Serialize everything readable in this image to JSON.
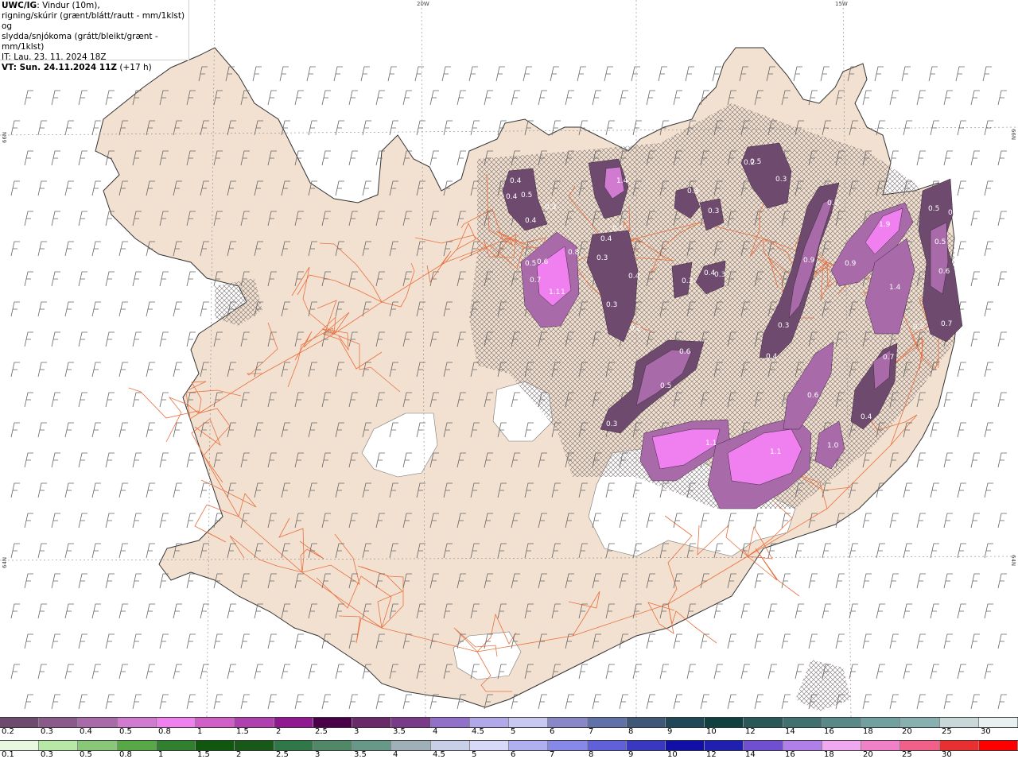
{
  "info": {
    "title_bold": "UWC/IG",
    "title_rest": ": Vindur (10m),",
    "line2": "rigning/skúrir (grænt/blátt/rautt - mm/1klst) og",
    "line3": "slydda/snjókoma (grátt/bleikt/grænt - mm/1klst)",
    "it": "IT: Lau. 23. 11. 2024 18Z",
    "vt_bold": "VT: Sun. 24.11.2024 11Z",
    "vt_rest": " (+17 h)"
  },
  "coords": {
    "top_left": "20W",
    "top_right": "15W",
    "left_upper": "66N",
    "right_upper": "66N",
    "left_lower": "64N",
    "right_lower": "64N"
  },
  "legend_snow": {
    "labels": [
      "0.2",
      "0.3",
      "0.4",
      "0.5",
      "0.8",
      "1",
      "1.5",
      "2",
      "2.5",
      "3",
      "3.5",
      "4",
      "4.5",
      "5",
      "6",
      "7",
      "8",
      "9",
      "10",
      "12",
      "14",
      "16",
      "18",
      "20",
      "25",
      "30"
    ],
    "colors": [
      "#6e4a6e",
      "#8a5a8a",
      "#a86aa8",
      "#d07ad0",
      "#f080f0",
      "#d060c8",
      "#b040b0",
      "#901890",
      "#4a0048",
      "#6a2a6a",
      "#7a3a8a",
      "#9070c8",
      "#b0a8e8",
      "#c8c8f0",
      "#8888c8",
      "#6070a8",
      "#405878",
      "#204858",
      "#104040",
      "#285858",
      "#407070",
      "#588888",
      "#70a0a0",
      "#88b0b0",
      "#c8d8d8",
      "#e8f0f0"
    ]
  },
  "legend_rain": {
    "labels": [
      "0.1",
      "0.3",
      "0.5",
      "0.8",
      "1",
      "1.5",
      "2",
      "2.5",
      "3",
      "3.5",
      "4",
      "4.5",
      "5",
      "6",
      "7",
      "8",
      "9",
      "10",
      "12",
      "14",
      "16",
      "18",
      "20",
      "25",
      "30"
    ],
    "colors": [
      "#e8f8e0",
      "#b8e8a8",
      "#88c878",
      "#58a848",
      "#308030",
      "#105810",
      "#185818",
      "#307848",
      "#508868",
      "#689888",
      "#a0b0b8",
      "#c8d0e8",
      "#d8d8f8",
      "#b0b0f0",
      "#8888e8",
      "#6060d8",
      "#3838c0",
      "#1010a8",
      "#2020b0",
      "#7050d0",
      "#b080e8",
      "#f0a8f0",
      "#f080c8",
      "#f06088",
      "#e83030",
      "#ff0000"
    ]
  },
  "precip_labels": [
    "0.4",
    "0.5",
    "0.3",
    "0.4",
    "0.4",
    "1.4",
    "0.5",
    "0.4",
    "0.3",
    "0.4",
    "0.3",
    "0.2",
    "0.6",
    "0.8",
    "0.7",
    "1.1",
    "1",
    "0.5",
    "0.3",
    "0.3",
    "0.2",
    "0.3",
    "0.4",
    "0.3",
    "0.3",
    "0.5",
    "0.7",
    "0.9",
    "0.9",
    "1.9",
    "0.5",
    "0.4",
    "0.5",
    "0.6",
    "1.4",
    "0.7",
    "0.3",
    "0.3",
    "0.4",
    "0.6",
    "0.5",
    "0.3",
    "1.1",
    "1.1",
    "0.6",
    "0.4",
    "1.0",
    "0.7"
  ]
}
